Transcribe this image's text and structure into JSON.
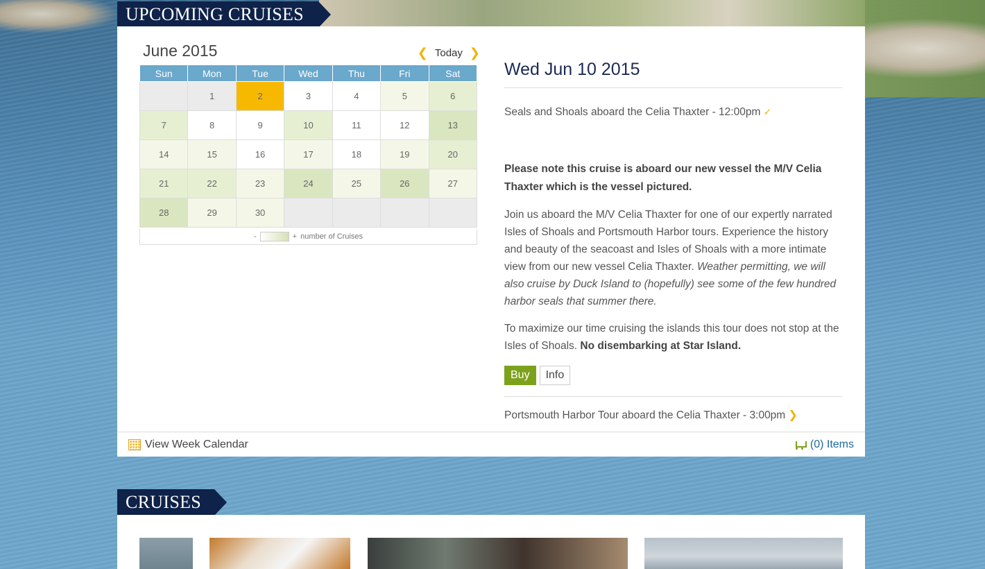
{
  "sections": {
    "upcoming_title": "UPCOMING CRUISES",
    "cruises_title": "CRUISES"
  },
  "calendar": {
    "month_title": "June 2015",
    "today_label": "Today",
    "weekdays": [
      "Sun",
      "Mon",
      "Tue",
      "Wed",
      "Thu",
      "Fri",
      "Sat"
    ],
    "weeks": [
      [
        "",
        "1",
        "2",
        "3",
        "4",
        "5",
        "6"
      ],
      [
        "7",
        "8",
        "9",
        "10",
        "11",
        "12",
        "13"
      ],
      [
        "14",
        "15",
        "16",
        "17",
        "18",
        "19",
        "20"
      ],
      [
        "21",
        "22",
        "23",
        "24",
        "25",
        "26",
        "27"
      ],
      [
        "28",
        "29",
        "30",
        "",
        "",
        "",
        ""
      ]
    ],
    "legend_minus": "-",
    "legend_plus": "+",
    "legend_label": "number of Cruises"
  },
  "detail": {
    "date": "Wed Jun 10 2015",
    "event1": "Seals and Shoals aboard the Celia Thaxter - 12:00pm",
    "note": "Please note this cruise is aboard our new vessel the M/V Celia Thaxter which is the vessel pictured.",
    "para1_main": "Join us aboard the M/V Celia Thaxter for one of our expertly narrated Isles of Shoals and Portsmouth Harbor tours.   Experience the history and beauty of the seacoast and Isles of Shoals with a more intimate view from our new vessel Celia Thaxter.  ",
    "para1_italic": "Weather permitting, we will also cruise by Duck Island to (hopefully) see some of the few hundred harbor seals that summer there.",
    "para2_main": "To maximize our time cruising the islands this tour does not stop at the Isles of Shoals. ",
    "para2_bold": "No disembarking at Star Island.",
    "buy_label": "Buy",
    "info_label": "Info",
    "event2": "Portsmouth Harbor Tour aboard the Celia Thaxter - 3:00pm"
  },
  "footer": {
    "week_calendar_label": "View Week Calendar",
    "cart_label": "(0) Items"
  },
  "colors": {
    "navy": "#0f2249",
    "accent_yellow": "#f7b800",
    "buy_green": "#7ca21c",
    "header_blue": "#6aa8cc"
  }
}
